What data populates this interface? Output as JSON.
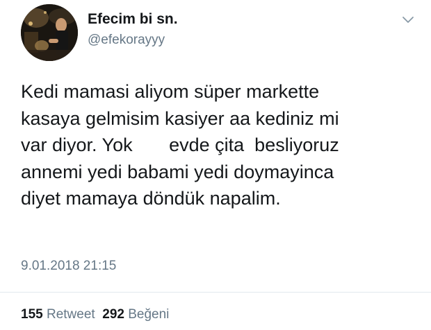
{
  "user": {
    "display_name": "Efecim bi sn.",
    "handle": "@efekorayyy"
  },
  "tweet": {
    "lines": [
      "Kedi mamasi aliyom süper markette",
      "kasaya gelmisim kasiyer aa kediniz mi",
      "var diyor. Yok       evde çita  besliyoruz",
      "annemi yedi babami yedi doymayinca",
      "diyet mamaya döndük napalim."
    ],
    "timestamp": "9.01.2018 21:15"
  },
  "stats": {
    "retweets_count": "155",
    "retweets_label": "Retweet",
    "likes_count": "292",
    "likes_label": "Beğeni"
  },
  "icons": {
    "menu": "chevron-down-icon"
  },
  "colors": {
    "text_primary": "#14171a",
    "text_secondary": "#657786",
    "divider": "#e1e8ed"
  }
}
